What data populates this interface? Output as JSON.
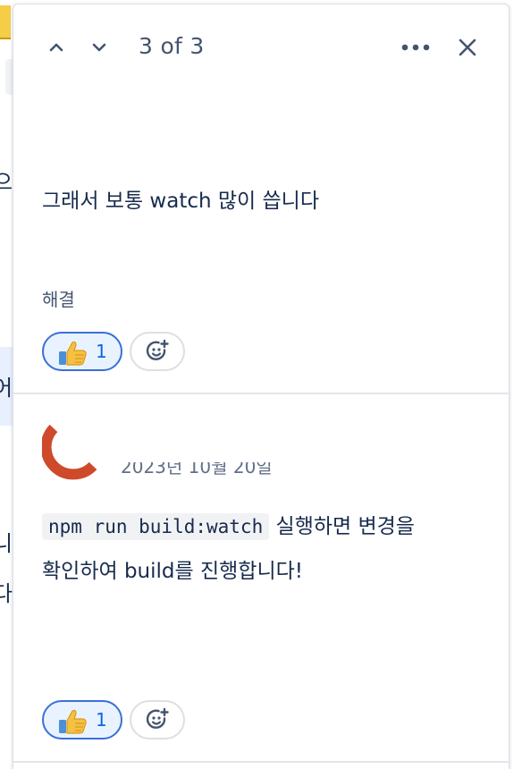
{
  "background_page": {
    "glyphs": [
      "!",
      "으",
      "어",
      "니",
      "다"
    ]
  },
  "header": {
    "counter": "3 of 3",
    "prev_icon": "chevron-up-icon",
    "next_icon": "chevron-down-icon",
    "more_icon": "more-horizontal-icon",
    "close_icon": "close-icon"
  },
  "comments": [
    {
      "text": "그래서 보통 watch 많이 씁니다",
      "status": "해결",
      "reactions": [
        {
          "emoji": "thumbs-up",
          "count": "1"
        }
      ]
    },
    {
      "date": "2023년 10월 20일",
      "code": "npm run build:watch",
      "text_after_code": " 실행하면 변경을",
      "text_line2": "확인하여 build를 진행합니다!",
      "reactions": [
        {
          "emoji": "thumbs-up",
          "count": "1"
        }
      ]
    }
  ],
  "colors": {
    "accent": "#0c66e4",
    "chip_border": "#3b6fd8",
    "chip_bg": "#e9f2ff",
    "avatar": "#ce4a2b"
  }
}
